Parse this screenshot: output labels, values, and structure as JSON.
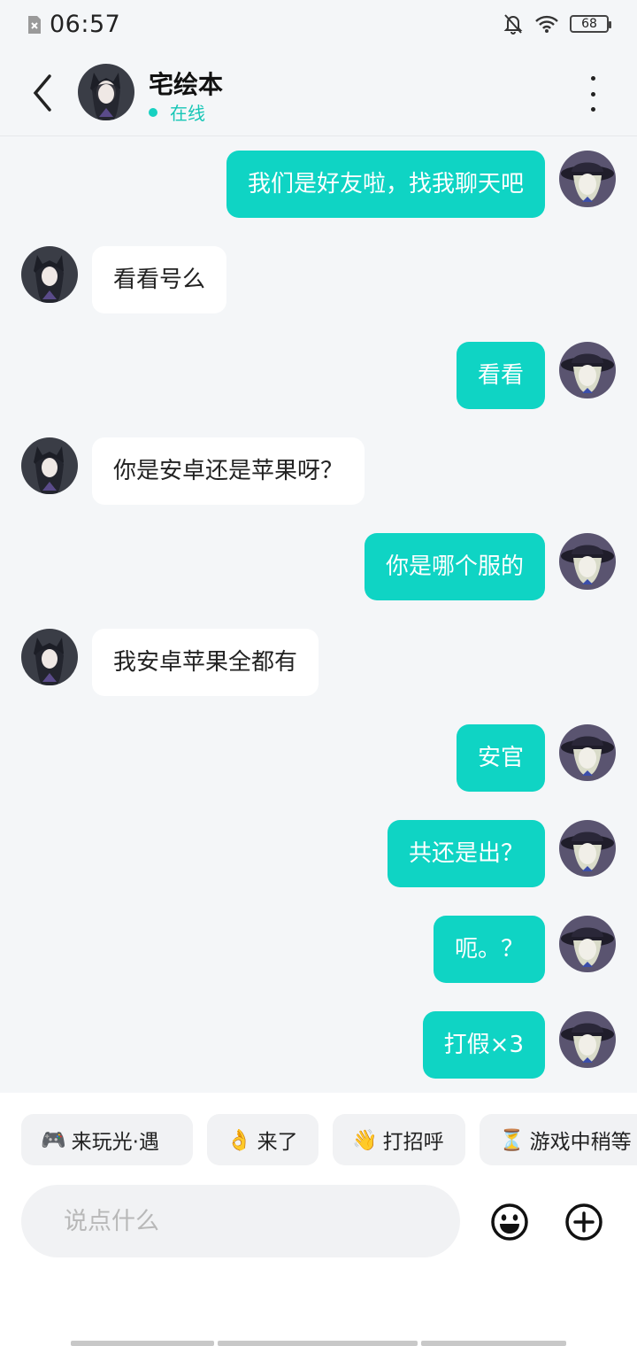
{
  "status_bar": {
    "time": "06:57",
    "battery": "68",
    "icons": [
      "sim-error-icon",
      "mute-bell-icon",
      "wifi-icon",
      "battery-icon"
    ]
  },
  "header": {
    "name": "宅绘本",
    "status": "在线",
    "status_color": "#17d1c1"
  },
  "messages": [
    {
      "side": "out",
      "text": "我们是好友啦，找我聊天吧"
    },
    {
      "side": "in",
      "text": "看看号么"
    },
    {
      "side": "out",
      "text": "看看"
    },
    {
      "side": "in",
      "text": "你是安卓还是苹果呀？"
    },
    {
      "side": "out",
      "text": "你是哪个服的"
    },
    {
      "side": "in",
      "text": "我安卓苹果全都有"
    },
    {
      "side": "out",
      "text": "安官"
    },
    {
      "side": "out",
      "text": "共还是出？"
    },
    {
      "side": "out",
      "text": "呃。？"
    },
    {
      "side": "out",
      "text": "打假×3"
    }
  ],
  "quick_replies": [
    {
      "emoji": "🎮",
      "label": "来玩光·遇"
    },
    {
      "emoji": "👌",
      "label": "来了"
    },
    {
      "emoji": "👋",
      "label": "打招呼"
    },
    {
      "emoji": "⏳",
      "label": "游戏中稍等"
    }
  ],
  "input": {
    "placeholder": "说点什么",
    "value": ""
  },
  "colors": {
    "accent": "#0fd4c4",
    "background": "#f4f6f8"
  }
}
